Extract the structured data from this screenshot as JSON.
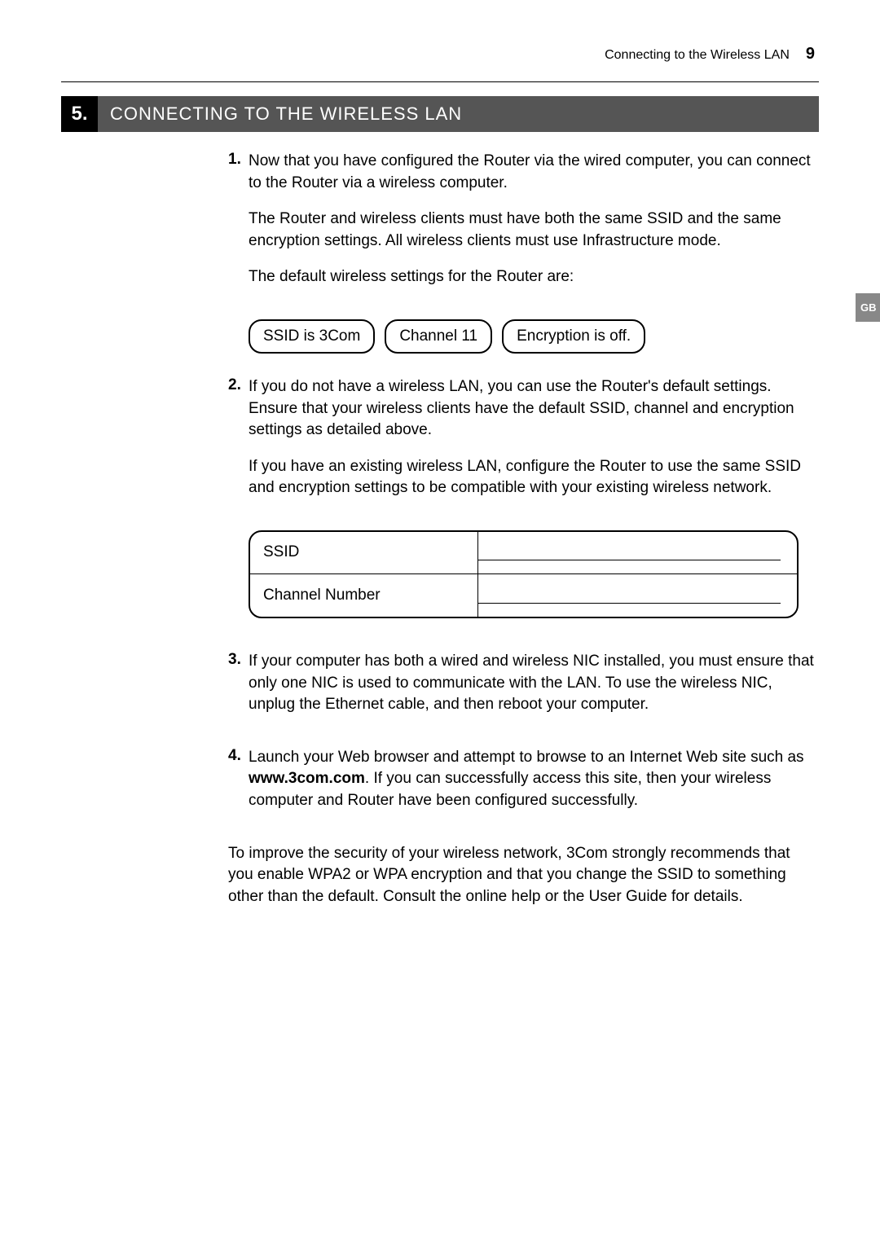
{
  "header": {
    "title": "Connecting to the Wireless LAN",
    "page_number": "9"
  },
  "section": {
    "number": "5.",
    "title": "CONNECTING TO THE WIRELESS LAN"
  },
  "steps": {
    "s1": {
      "num": "1.",
      "p1": "Now that you have configured the Router via the wired computer, you can connect to the Router via a wireless computer.",
      "p2": "The Router and wireless clients must have both the same SSID and the same encryption settings. All wireless clients must use Infrastructure mode.",
      "p3": "The default wireless settings for the Router are:"
    },
    "pills": {
      "ssid": "SSID is 3Com",
      "channel": "Channel 11",
      "encryption": "Encryption is off."
    },
    "s2": {
      "num": "2.",
      "p1": "If you do not have a wireless LAN, you can use the Router's default settings. Ensure that your wireless clients have the default SSID, channel and encryption settings as detailed above.",
      "p2": "If you have an existing wireless LAN, configure the Router to use the same SSID and encryption settings to be compatible with your existing wireless network."
    },
    "table": {
      "row1_label": "SSID",
      "row2_label": "Channel Number"
    },
    "s3": {
      "num": "3.",
      "p1": "If your computer has both a wired and wireless NIC installed, you must ensure that only one NIC is used to communicate with the LAN. To use the wireless NIC, unplug the Ethernet cable, and then reboot your computer."
    },
    "s4": {
      "num": "4.",
      "p1_a": "Launch your Web browser and attempt to browse to an Internet Web site such as ",
      "p1_bold": "www.3com.com",
      "p1_b": ". If you can successfully access this site, then your wireless computer and Router have been configured successfully."
    },
    "closing": "To improve the security of your wireless network, 3Com strongly recommends that you enable WPA2 or WPA encryption and that you change the SSID to something other than the default. Consult the online help or the User Guide for details."
  },
  "lang_tab": "GB"
}
